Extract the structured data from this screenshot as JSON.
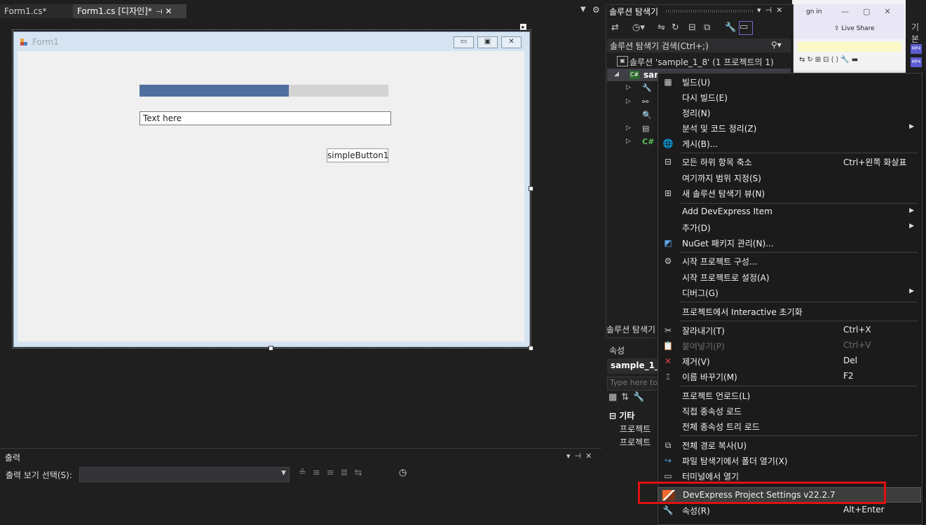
{
  "editor": {
    "tabs": [
      {
        "label": "Form1.cs*"
      },
      {
        "label": "Form1.cs [디자인]*"
      }
    ]
  },
  "form": {
    "title": "Form1",
    "progress_fraction": 0.6,
    "textbox_value": "Text here",
    "button_label": "simpleButton1"
  },
  "output": {
    "title": "출력",
    "select_label": "출력 보기 선택(S):",
    "select_value": ""
  },
  "solution_explorer": {
    "title": "솔루션 탐색기",
    "search_placeholder": "솔루션 탐색기 검색(Ctrl+;)",
    "solution_label": "솔루션 'sample_1_8' (1 프로젝트의 1)",
    "project_label": "sam",
    "bottom_tab": "솔루션 탐색기"
  },
  "properties": {
    "title": "속성",
    "object": "sample_1_8",
    "filter_placeholder": "Type here to",
    "category": "기타",
    "rows": [
      "프로젝트",
      "프로젝트"
    ]
  },
  "background_window": {
    "signin": "gn in",
    "liveshare": "Live Share"
  },
  "right_strip": {
    "label": "기본",
    "badge": "MP4"
  },
  "context_menu": {
    "items": [
      {
        "label": "빌드(U)",
        "shortcut": "",
        "icon": "build-icon"
      },
      {
        "label": "다시 빌드(E)",
        "shortcut": "",
        "icon": ""
      },
      {
        "label": "정리(N)",
        "shortcut": "",
        "icon": ""
      },
      {
        "label": "분석 및 코드 정리(Z)",
        "shortcut": "",
        "icon": "",
        "submenu": true
      },
      {
        "label": "게시(B)...",
        "shortcut": "",
        "icon": "globe-icon"
      },
      {
        "label": "모든 하위 항목 축소",
        "shortcut": "Ctrl+왼쪽 화살표",
        "icon": "collapse-icon"
      },
      {
        "label": "여기까지 범위 지정(S)",
        "shortcut": "",
        "icon": ""
      },
      {
        "label": "새 솔루션 탐색기 뷰(N)",
        "shortcut": "",
        "icon": "new-view-icon"
      },
      {
        "label": "Add DevExpress Item",
        "shortcut": "",
        "icon": "",
        "submenu": true
      },
      {
        "label": "추가(D)",
        "shortcut": "",
        "icon": "",
        "submenu": true
      },
      {
        "label": "NuGet 패키지 관리(N)...",
        "shortcut": "",
        "icon": "nuget-icon"
      },
      {
        "label": "시작 프로젝트 구성...",
        "shortcut": "",
        "icon": "gear-icon"
      },
      {
        "label": "시작 프로젝트로 설정(A)",
        "shortcut": "",
        "icon": ""
      },
      {
        "label": "디버그(G)",
        "shortcut": "",
        "icon": "",
        "submenu": true
      },
      {
        "label": "프로젝트에서 Interactive 초기화",
        "shortcut": "",
        "icon": ""
      },
      {
        "label": "잘라내기(T)",
        "shortcut": "Ctrl+X",
        "icon": "scissors-icon"
      },
      {
        "label": "붙여넣기(P)",
        "shortcut": "Ctrl+V",
        "icon": "paste-icon",
        "disabled": true
      },
      {
        "label": "제거(V)",
        "shortcut": "Del",
        "icon": "delete-icon"
      },
      {
        "label": "이름 바꾸기(M)",
        "shortcut": "F2",
        "icon": "rename-icon"
      },
      {
        "label": "프로젝트 언로드(L)",
        "shortcut": "",
        "icon": ""
      },
      {
        "label": "직접 종속성 로드",
        "shortcut": "",
        "icon": ""
      },
      {
        "label": "전체 종속성 트리 로드",
        "shortcut": "",
        "icon": ""
      },
      {
        "label": "전체 경로 복사(U)",
        "shortcut": "",
        "icon": "copy-icon"
      },
      {
        "label": "파일 탐색기에서 폴더 열기(X)",
        "shortcut": "",
        "icon": "open-folder-icon"
      },
      {
        "label": "터미널에서 열기",
        "shortcut": "",
        "icon": "terminal-icon"
      },
      {
        "label": "DevExpress Project Settings v22.2.7",
        "shortcut": "",
        "icon": "devexpress-icon",
        "highlighted": true
      },
      {
        "label": "속성(R)",
        "shortcut": "Alt+Enter",
        "icon": "wrench-icon"
      }
    ]
  },
  "colors": {
    "highlight_box": "#e01010",
    "progress_fill": "#4f6f9f",
    "ide_background": "#1f1f1f"
  }
}
